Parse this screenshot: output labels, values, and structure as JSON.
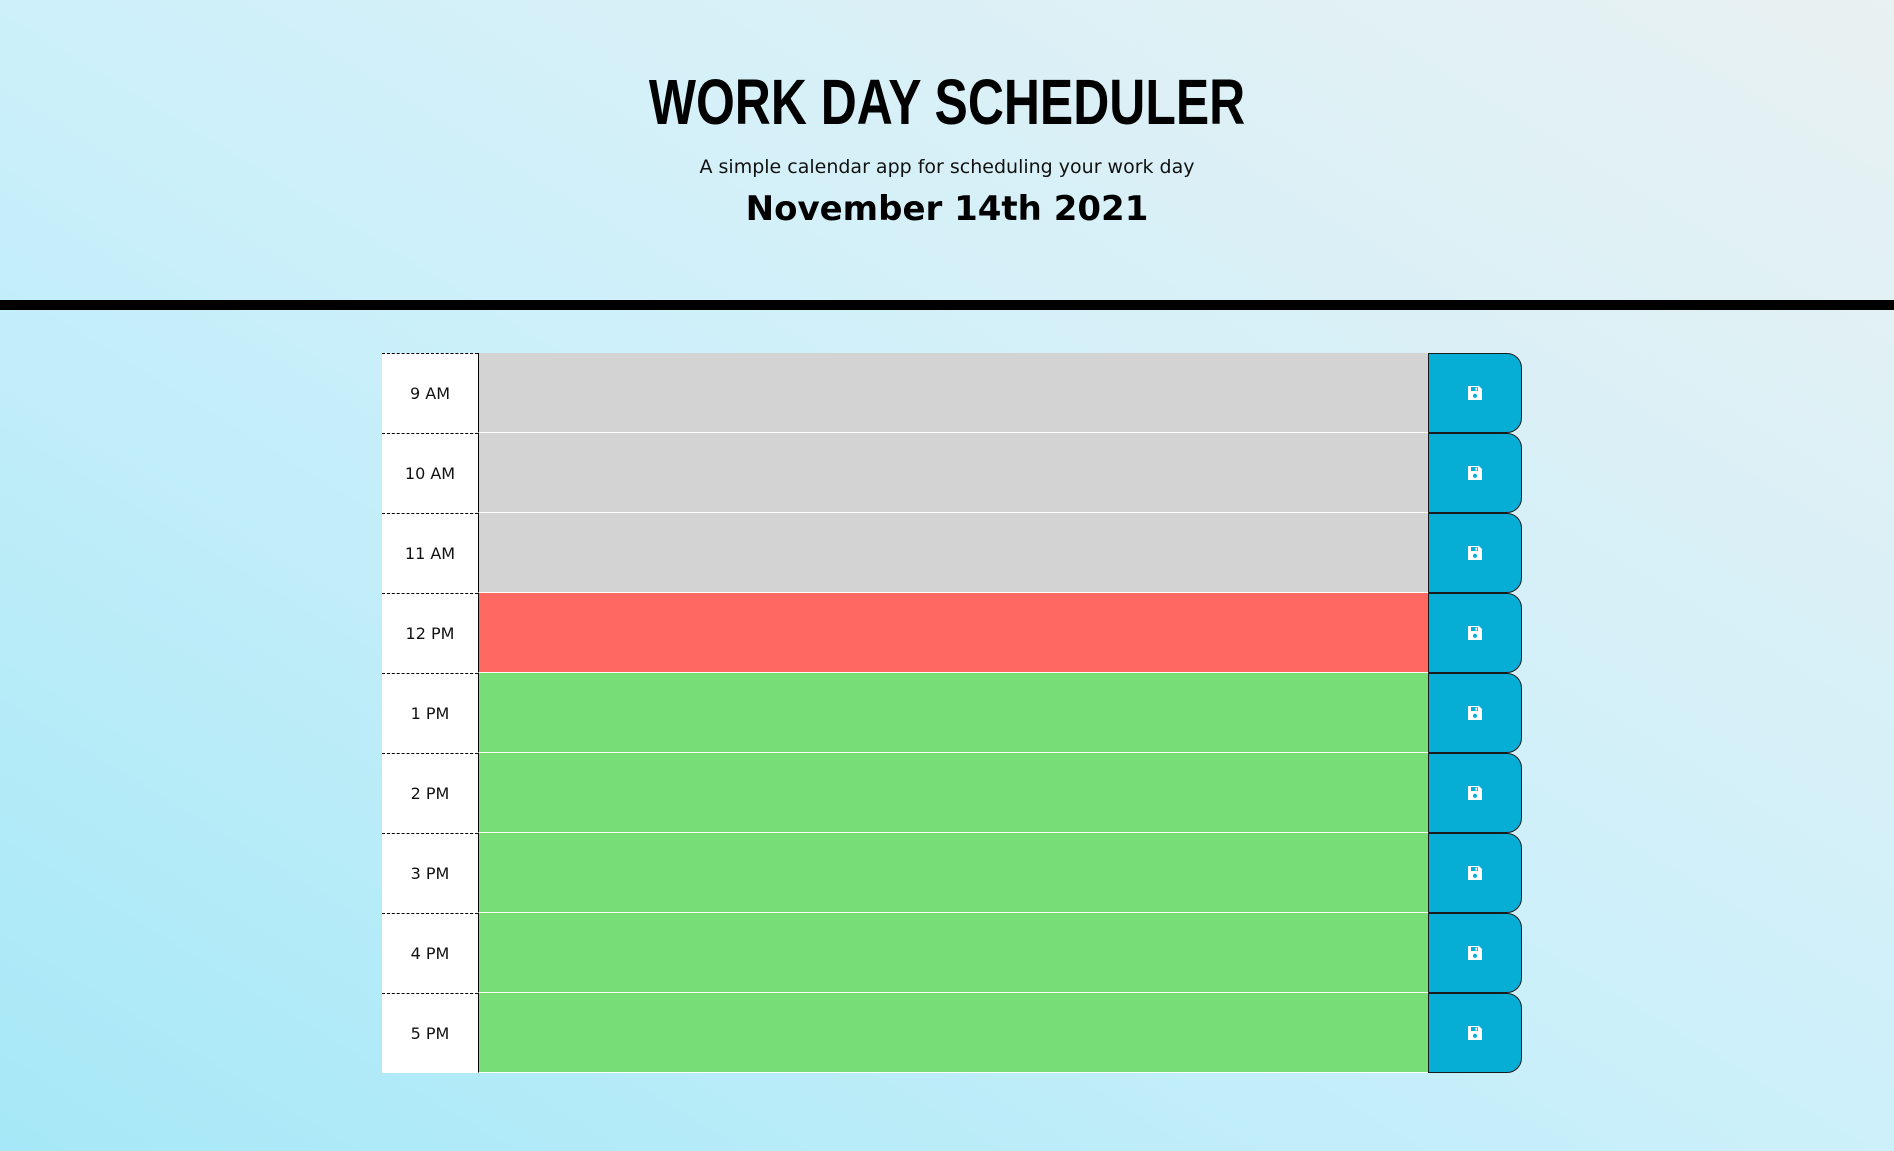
{
  "header": {
    "title": "WORK DAY SCHEDULER",
    "subtitle": "A simple calendar app for scheduling your work day",
    "current_date": "November 14th 2021"
  },
  "colors": {
    "past": "#d3d3d3",
    "present": "#ff6961",
    "future": "#77dd77",
    "save_button": "#06aed5"
  },
  "time_blocks": [
    {
      "hour": "9 AM",
      "status": "past",
      "text": "",
      "save_icon": "floppy-disk-icon"
    },
    {
      "hour": "10 AM",
      "status": "past",
      "text": "",
      "save_icon": "floppy-disk-icon"
    },
    {
      "hour": "11 AM",
      "status": "past",
      "text": "",
      "save_icon": "floppy-disk-icon"
    },
    {
      "hour": "12 PM",
      "status": "present",
      "text": "",
      "save_icon": "floppy-disk-icon"
    },
    {
      "hour": "1 PM",
      "status": "future",
      "text": "",
      "save_icon": "floppy-disk-icon"
    },
    {
      "hour": "2 PM",
      "status": "future",
      "text": "",
      "save_icon": "floppy-disk-icon"
    },
    {
      "hour": "3 PM",
      "status": "future",
      "text": "",
      "save_icon": "floppy-disk-icon"
    },
    {
      "hour": "4 PM",
      "status": "future",
      "text": "",
      "save_icon": "floppy-disk-icon"
    },
    {
      "hour": "5 PM",
      "status": "future",
      "text": "",
      "save_icon": "floppy-disk-icon"
    }
  ]
}
